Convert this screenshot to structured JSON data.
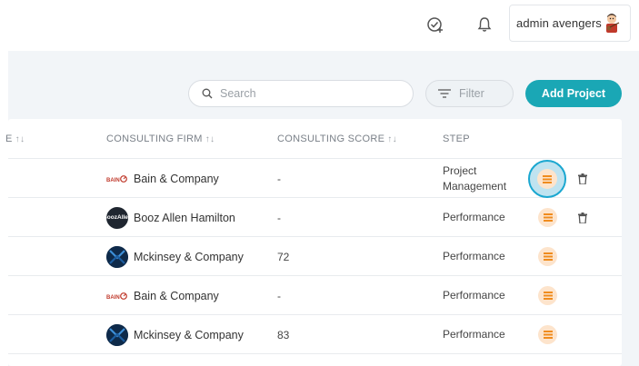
{
  "header": {
    "user_name": "admin avengers",
    "icons": [
      "check-plus-icon",
      "bell-icon",
      "avatar"
    ]
  },
  "toolbar": {
    "search_placeholder": "Search",
    "filter_label": "Filter",
    "add_label": "Add Project"
  },
  "table": {
    "columns": {
      "partial_label": "E",
      "firm": "CONSULTING FIRM",
      "score": "CONSULTING SCORE",
      "step": "STEP",
      "sort_glyph": "↑↓"
    },
    "rows": [
      {
        "firm": "Bain & Company",
        "logo": "bain",
        "logo_text": "BAIN",
        "score": "-",
        "step": "Project Management",
        "step_line1": "Project",
        "step_line2": "Management",
        "has_delete": true,
        "active": true
      },
      {
        "firm": "Booz Allen Hamilton",
        "logo": "booz",
        "logo_text_1": "Booz",
        "logo_text_2": "Allen",
        "score": "-",
        "step": "Performance",
        "has_delete": true,
        "active": false
      },
      {
        "firm": "Mckinsey & Company",
        "logo": "mckinsey",
        "score": "72",
        "step": "Performance",
        "has_delete": false,
        "active": false
      },
      {
        "firm": "Bain & Company",
        "logo": "bain",
        "logo_text": "BAIN",
        "score": "-",
        "step": "Performance",
        "has_delete": false,
        "active": false
      },
      {
        "firm": "Mckinsey & Company",
        "logo": "mckinsey",
        "score": "83",
        "step": "Performance",
        "has_delete": false,
        "active": false
      }
    ]
  },
  "colors": {
    "accent": "#1aa7b5",
    "list_button_bg": "#fde4cc",
    "list_button_icon": "#f08c1e",
    "page_bg": "#f2f5f8"
  }
}
